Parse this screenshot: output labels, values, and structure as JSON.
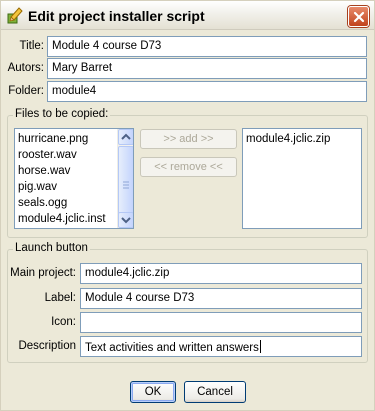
{
  "window": {
    "title": "Edit project installer script",
    "close_icon": "close-icon",
    "app_icon": "pencil-icon"
  },
  "fields": {
    "title_label": "Title:",
    "title_value": "Module 4 course D73",
    "autors_label": "Autors:",
    "autors_value": "Mary Barret",
    "folder_label": "Folder:",
    "folder_value": "module4"
  },
  "files": {
    "legend": "Files to be copied:",
    "available": [
      "hurricane.png",
      "rooster.wav",
      "horse.wav",
      "pig.wav",
      "seals.ogg",
      "module4.jclic.inst"
    ],
    "add_label": ">> add >>",
    "remove_label": "<< remove <<",
    "selected": [
      "module4.jclic.zip"
    ]
  },
  "launch": {
    "legend": "Launch button",
    "main_project_label": "Main project:",
    "main_project_value": "module4.jclic.zip",
    "label_label": "Label:",
    "label_value": "Module 4 course D73",
    "icon_label": "Icon:",
    "icon_value": "",
    "description_label": "Description",
    "description_value": "Text activities and written answers"
  },
  "buttons": {
    "ok": "OK",
    "cancel": "Cancel"
  },
  "colors": {
    "window_bg": "#ece9d8",
    "field_border": "#7f9db9",
    "close_red": "#c1431d"
  }
}
